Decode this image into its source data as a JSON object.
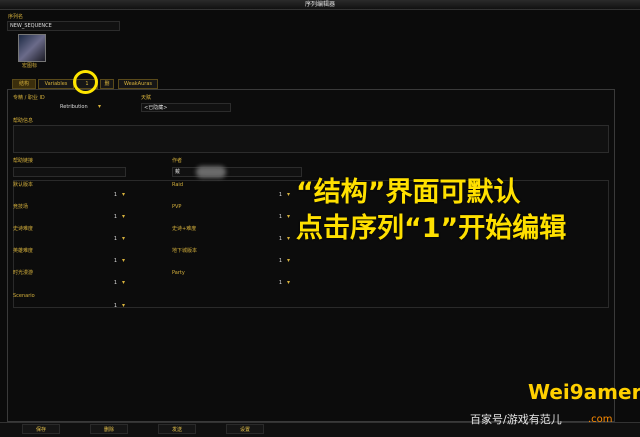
{
  "window": {
    "title": "序列编辑器"
  },
  "sequence": {
    "name_label": "序列名",
    "name_value": "NEW_SEQUENCE",
    "icon_label": "宏图标"
  },
  "tabs": [
    {
      "label": "结构",
      "active": true
    },
    {
      "label": "Variables",
      "active": false
    },
    {
      "label": "1",
      "active": false
    },
    {
      "label": "删",
      "active": false
    },
    {
      "label": "WeakAuras",
      "active": false
    }
  ],
  "spec": {
    "label": "专精 / 职业 ID",
    "value": "Retribution"
  },
  "talent": {
    "label": "天赋",
    "value": "<已隐藏>"
  },
  "help_info": {
    "label": "帮助信息"
  },
  "help_link": {
    "label": "帮助链接"
  },
  "author": {
    "label": "作者",
    "value": "戴"
  },
  "fields": [
    {
      "label": "默认版本",
      "value": "1"
    },
    {
      "label": "Raid",
      "value": "1"
    },
    {
      "label": "竞技场",
      "value": "1"
    },
    {
      "label": "PVP",
      "value": "1"
    },
    {
      "label": "史诗难度",
      "value": "1"
    },
    {
      "label": "史诗+难度",
      "value": "1"
    },
    {
      "label": "英雄难度",
      "value": "1"
    },
    {
      "label": "地下城版本",
      "value": "1"
    },
    {
      "label": "时光漫游",
      "value": "1"
    },
    {
      "label": "Party",
      "value": "1"
    },
    {
      "label": "Scenario",
      "value": "1"
    }
  ],
  "buttons": {
    "save": "保存",
    "delete": "删除",
    "send": "发送",
    "settings": "设置"
  },
  "overlay": {
    "line1": "“结构”界面可默认",
    "line2": "点击序列“1”开始编辑"
  },
  "watermark": {
    "source": "百家号/游戏有范儿",
    "logo": "Wei9amer",
    "logo_sub": ".com"
  },
  "colors": {
    "accent": "#d6b13c",
    "highlight": "#ffe000"
  }
}
